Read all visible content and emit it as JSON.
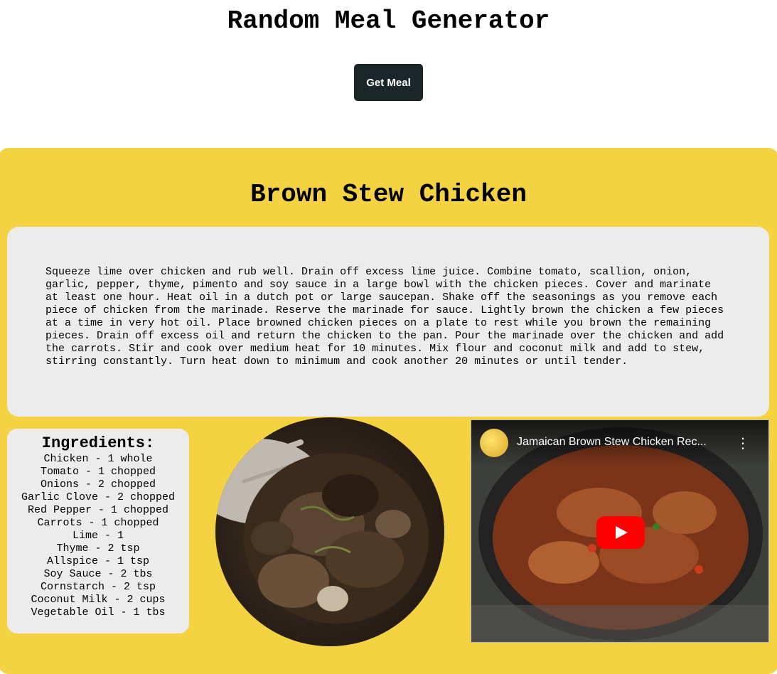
{
  "header": {
    "title": "Random Meal Generator",
    "get_meal_label": "Get Meal"
  },
  "meal": {
    "name": "Brown Stew Chicken",
    "instructions": "Squeeze lime over chicken and rub well. Drain off excess lime juice. Combine tomato, scallion, onion, garlic, pepper, thyme, pimento and soy sauce in a large bowl with the chicken pieces. Cover and marinate at least one hour. Heat oil in a dutch pot or large saucepan. Shake off the seasonings as you remove each piece of chicken from the marinade. Reserve the marinade for sauce. Lightly brown the chicken a few pieces at a time in very hot oil. Place browned chicken pieces on a plate to rest while you brown the remaining pieces. Drain off excess oil and return the chicken to the pan. Pour the marinade over the chicken and add the carrots. Stir and cook over medium heat for 10 minutes. Mix flour and coconut milk and add to stew, stirring constantly. Turn heat down to minimum and cook another 20 minutes or until tender.",
    "ingredients_title": "Ingredients:",
    "ingredients": [
      "Chicken - 1 whole",
      "Tomato - 1 chopped",
      "Onions - 2 chopped",
      "Garlic Clove - 2 chopped",
      "Red Pepper - 1 chopped",
      "Carrots - 1 chopped",
      "Lime - 1",
      "Thyme - 2 tsp",
      "Allspice - 1 tsp",
      "Soy Sauce - 2 tbs",
      "Cornstarch - 2 tsp",
      "Coconut Milk - 2 cups",
      "Vegetable Oil - 1 tbs"
    ]
  },
  "video": {
    "title": "Jamaican Brown Stew Chicken Rec...",
    "more_icon": "vertical-ellipsis-icon",
    "play_icon": "youtube-play-icon"
  },
  "colors": {
    "card_background": "#f4d242",
    "panel_background": "#ececec",
    "button_background": "#1b2629",
    "play_button": "#ff0000"
  }
}
